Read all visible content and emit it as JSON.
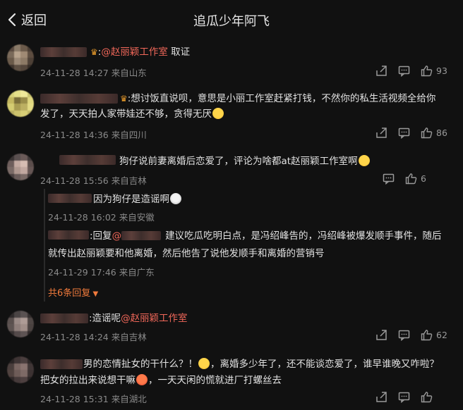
{
  "header": {
    "back_label": "返回",
    "title": "追瓜少年阿飞"
  },
  "comments": [
    {
      "text_prefix": ":",
      "mention": "@赵丽颖工作室",
      "text_suffix": " 取证",
      "meta": "24-11-28 14:27 来自山东",
      "likes": "93"
    },
    {
      "line1": ":想讨饭直说呗，意思是小丽工作室赶紧打钱，不然你的私生活视频全给你",
      "line2": "发了，天天拍人家带娃还不够，贪得无厌",
      "meta": "24-11-28 14:36 来自四川",
      "likes": "86"
    },
    {
      "text": "狗仔说前妻离婚后恋爱了，评论为啥都at赵丽颖工作室啊",
      "meta": "24-11-28 15:56 来自吉林",
      "likes": "6",
      "replies": [
        {
          "text": "因为狗仔是造谣啊",
          "meta": "24-11-28 16:02 来自安徽"
        },
        {
          "prefix": ":回复",
          "mention": "@",
          "line1": "建议吃瓜吃明白点，是冯绍峰告的，冯绍峰被爆发顺手事件，随后",
          "line2": "就传出赵丽颖要和他离婚，然后他告了说他发顺手和离婚的营销号",
          "meta": "24-11-29 17:46 来自广东"
        }
      ],
      "more_label": "共6条回复"
    },
    {
      "text_prefix": ":造谣呢",
      "mention": "@赵丽颖工作室",
      "meta": "24-11-28 14:24 来自吉林",
      "likes": "62"
    },
    {
      "line1a": "男的恋情扯女的干什么？！",
      "line1b": "，离婚多少年了，还不能谈恋爱了，谁早谁晚又咋啦？",
      "line2a": "把女的拉出来说想干嘛",
      "line2b": "，一天天闲的慌就进厂打螺丝去",
      "meta": "24-11-28 15:31 来自湖北",
      "likes": ""
    }
  ],
  "icons": {
    "back": "chevron-left-icon",
    "share": "share-icon",
    "comment": "comment-icon",
    "like": "thumbs-up-icon"
  },
  "colors": {
    "background": "#111111",
    "mention": "#f2685a",
    "vip_badge": "#e89b2b",
    "more_replies": "#f07a3c",
    "meta": "#8a8a8a"
  }
}
